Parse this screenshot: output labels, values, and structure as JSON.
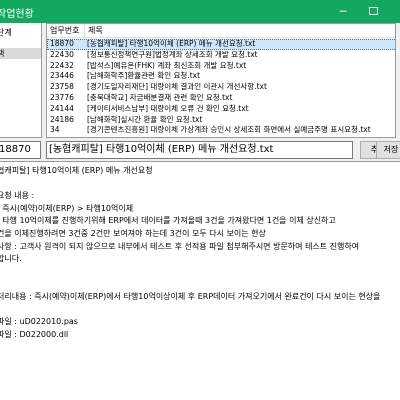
{
  "window": {
    "title": "작업현황"
  },
  "left_panel": {
    "items": [
      "단계",
      "",
      "책",
      "",
      "",
      "",
      ""
    ],
    "selected_index": 2
  },
  "list": {
    "headers": [
      "업무번호",
      "제목"
    ],
    "rows": [
      {
        "no": "18870",
        "title": "[농협캐피탈] 타행10억이체 (ERP) 메뉴 개선요청.txt",
        "selected": true
      },
      {
        "no": "22430",
        "title": "[청보통신정책연구원]법정계좌 상세조회 개발 요청.txt",
        "selected": false
      },
      {
        "no": "22432",
        "title": "[밥석스]예유온(FHK) 계좌 최신조회 개발 요청.txt",
        "selected": false
      },
      {
        "no": "23446",
        "title": "[남해화학주]환율관련 확인 요청.txt",
        "selected": false
      },
      {
        "no": "23758",
        "title": "[경기도일자리재단] 대량이체 결과인 이관시 개선사항.txt",
        "selected": false
      },
      {
        "no": "23776",
        "title": "[충북대학교] 자금배분결재 관련 확인 요청.txt",
        "selected": false
      },
      {
        "no": "24144",
        "title": "[케이티서비스남부] 대량이체 오류 건 확인 요청.txt",
        "selected": false
      },
      {
        "no": "24186",
        "title": "[남해화학]실시간 환율 확인 요청.txt",
        "selected": false
      },
      {
        "no": "34",
        "title": "[경기콘텐츠진흥원] 대량이체 가상계좌 승인시 상세조회 화면에서 실예금주명 표시요청.txt",
        "selected": false
      }
    ]
  },
  "form": {
    "doc_no": "18870",
    "subject": "[농협캐피탈] 타행10억이체 (ERP) 메뉴 개선요청.txt",
    "add_label": "추가",
    "save_label": "저장"
  },
  "content": {
    "lines": [
      "협캐피탈] 타행10억이체 (ERP) 메뉴 개선요청",
      "",
      "요청 내용 :",
      ": 즉시(예약)이체(ERP) > 타행10억이체",
      ": 타행 10억이체를 진행하기위해 ERP에서 데이터를 가져올때 3건을 가져왔다면 1건을 이체 상신하고",
      "건을 이체진행하려면 3건중 2건만 보여져야 하는데 3건이 모두 다시 보이는 현상",
      "사항 : 고객사 원격이 되지 않으므로 내부에서 테스트 후 선적용 파일 첨부해주시면 방문하여 테스트 진행하여",
      "합니다.",
      "",
      "",
      "처리내용 : 즉시(예약)이체(ERP)에서 타행10억이상이체 후 ERP데이터 가져오기에서 완료건이 다시 보이는 현상을",
      "",
      "파일 : uD022010.pas",
      "파일 : D022000.dll"
    ]
  }
}
